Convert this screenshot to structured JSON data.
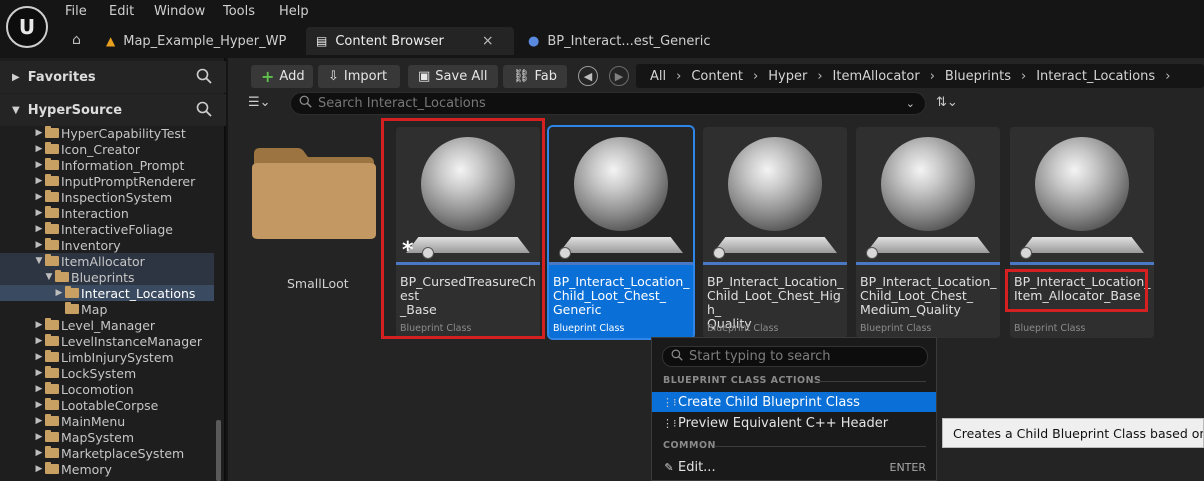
{
  "menu": [
    "File",
    "Edit",
    "Window",
    "Tools",
    "Help"
  ],
  "tabs": [
    {
      "label": "Map_Example_Hyper_WP"
    },
    {
      "label": "Content Browser",
      "close": "×"
    },
    {
      "label": "BP_Interact...est_Generic"
    }
  ],
  "favorites": {
    "label": "Favorites"
  },
  "source": {
    "label": "HyperSource"
  },
  "tree": [
    {
      "label": "HyperCapabilityTest"
    },
    {
      "label": "Icon_Creator"
    },
    {
      "label": "Information_Prompt"
    },
    {
      "label": "InputPromptRenderer"
    },
    {
      "label": "InspectionSystem"
    },
    {
      "label": "Interaction"
    },
    {
      "label": "InteractiveFoliage"
    },
    {
      "label": "Inventory"
    },
    {
      "label": "ItemAllocator"
    },
    {
      "label": "Blueprints"
    },
    {
      "label": "Interact_Locations"
    },
    {
      "label": "Map"
    },
    {
      "label": "Level_Manager"
    },
    {
      "label": "LevelInstanceManager"
    },
    {
      "label": "LimbInjurySystem"
    },
    {
      "label": "LockSystem"
    },
    {
      "label": "Locomotion"
    },
    {
      "label": "LootableCorpse"
    },
    {
      "label": "MainMenu"
    },
    {
      "label": "MapSystem"
    },
    {
      "label": "MarketplaceSystem"
    },
    {
      "label": "Memory"
    }
  ],
  "toolbar": {
    "add": "Add",
    "import": "Import",
    "save_all": "Save All",
    "fab": "Fab"
  },
  "breadcrumb": [
    "All",
    "Content",
    "Hyper",
    "ItemAllocator",
    "Blueprints",
    "Interact_Locations"
  ],
  "search": {
    "placeholder": "Search Interact_Locations"
  },
  "folder": {
    "label": "SmallLoot"
  },
  "assets": [
    {
      "name": "BP_CursedTreasureChest\n_Base",
      "type": "Blueprint Class"
    },
    {
      "name": "BP_Interact_Location_\nChild_Loot_Chest_\nGeneric",
      "type": "Blueprint Class"
    },
    {
      "name": "BP_Interact_Location_\nChild_Loot_Chest_High_\nQuality",
      "type": "Blueprint Class"
    },
    {
      "name": "BP_Interact_Location_\nChild_Loot_Chest_\nMedium_Quality",
      "type": "Blueprint Class"
    },
    {
      "name": "BP_Interact_Location_\nItem_Allocator_Base",
      "type": "Blueprint Class"
    }
  ],
  "context_menu": {
    "search_placeholder": "Start typing to search",
    "section_blueprint": "BLUEPRINT CLASS ACTIONS",
    "create_child": "Create Child Blueprint Class",
    "preview_cpp": "Preview Equivalent C++ Header",
    "section_common": "COMMON",
    "edit": "Edit...",
    "edit_shortcut": "ENTER"
  },
  "tooltip": {
    "text": "Creates a Child Blueprint Class based on the cu"
  },
  "colors": {
    "accent": "#0a70d8",
    "highlight_box": "#d42020",
    "folder": "#c8a063"
  }
}
